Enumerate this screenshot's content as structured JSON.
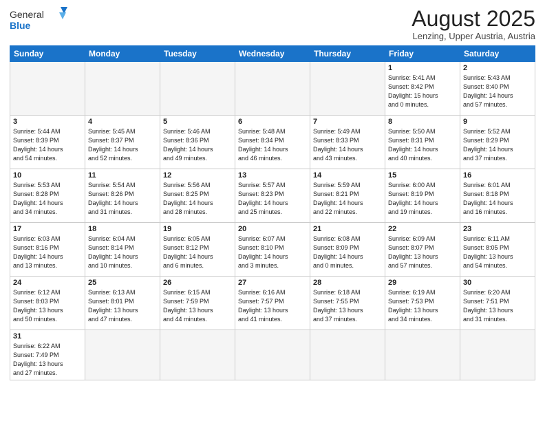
{
  "logo": {
    "text_general": "General",
    "text_blue": "Blue"
  },
  "title": "August 2025",
  "location": "Lenzing, Upper Austria, Austria",
  "weekdays": [
    "Sunday",
    "Monday",
    "Tuesday",
    "Wednesday",
    "Thursday",
    "Friday",
    "Saturday"
  ],
  "days": {
    "d1": {
      "num": "1",
      "info": "Sunrise: 5:41 AM\nSunset: 8:42 PM\nDaylight: 15 hours\nand 0 minutes."
    },
    "d2": {
      "num": "2",
      "info": "Sunrise: 5:43 AM\nSunset: 8:40 PM\nDaylight: 14 hours\nand 57 minutes."
    },
    "d3": {
      "num": "3",
      "info": "Sunrise: 5:44 AM\nSunset: 8:39 PM\nDaylight: 14 hours\nand 54 minutes."
    },
    "d4": {
      "num": "4",
      "info": "Sunrise: 5:45 AM\nSunset: 8:37 PM\nDaylight: 14 hours\nand 52 minutes."
    },
    "d5": {
      "num": "5",
      "info": "Sunrise: 5:46 AM\nSunset: 8:36 PM\nDaylight: 14 hours\nand 49 minutes."
    },
    "d6": {
      "num": "6",
      "info": "Sunrise: 5:48 AM\nSunset: 8:34 PM\nDaylight: 14 hours\nand 46 minutes."
    },
    "d7": {
      "num": "7",
      "info": "Sunrise: 5:49 AM\nSunset: 8:33 PM\nDaylight: 14 hours\nand 43 minutes."
    },
    "d8": {
      "num": "8",
      "info": "Sunrise: 5:50 AM\nSunset: 8:31 PM\nDaylight: 14 hours\nand 40 minutes."
    },
    "d9": {
      "num": "9",
      "info": "Sunrise: 5:52 AM\nSunset: 8:29 PM\nDaylight: 14 hours\nand 37 minutes."
    },
    "d10": {
      "num": "10",
      "info": "Sunrise: 5:53 AM\nSunset: 8:28 PM\nDaylight: 14 hours\nand 34 minutes."
    },
    "d11": {
      "num": "11",
      "info": "Sunrise: 5:54 AM\nSunset: 8:26 PM\nDaylight: 14 hours\nand 31 minutes."
    },
    "d12": {
      "num": "12",
      "info": "Sunrise: 5:56 AM\nSunset: 8:25 PM\nDaylight: 14 hours\nand 28 minutes."
    },
    "d13": {
      "num": "13",
      "info": "Sunrise: 5:57 AM\nSunset: 8:23 PM\nDaylight: 14 hours\nand 25 minutes."
    },
    "d14": {
      "num": "14",
      "info": "Sunrise: 5:59 AM\nSunset: 8:21 PM\nDaylight: 14 hours\nand 22 minutes."
    },
    "d15": {
      "num": "15",
      "info": "Sunrise: 6:00 AM\nSunset: 8:19 PM\nDaylight: 14 hours\nand 19 minutes."
    },
    "d16": {
      "num": "16",
      "info": "Sunrise: 6:01 AM\nSunset: 8:18 PM\nDaylight: 14 hours\nand 16 minutes."
    },
    "d17": {
      "num": "17",
      "info": "Sunrise: 6:03 AM\nSunset: 8:16 PM\nDaylight: 14 hours\nand 13 minutes."
    },
    "d18": {
      "num": "18",
      "info": "Sunrise: 6:04 AM\nSunset: 8:14 PM\nDaylight: 14 hours\nand 10 minutes."
    },
    "d19": {
      "num": "19",
      "info": "Sunrise: 6:05 AM\nSunset: 8:12 PM\nDaylight: 14 hours\nand 6 minutes."
    },
    "d20": {
      "num": "20",
      "info": "Sunrise: 6:07 AM\nSunset: 8:10 PM\nDaylight: 14 hours\nand 3 minutes."
    },
    "d21": {
      "num": "21",
      "info": "Sunrise: 6:08 AM\nSunset: 8:09 PM\nDaylight: 14 hours\nand 0 minutes."
    },
    "d22": {
      "num": "22",
      "info": "Sunrise: 6:09 AM\nSunset: 8:07 PM\nDaylight: 13 hours\nand 57 minutes."
    },
    "d23": {
      "num": "23",
      "info": "Sunrise: 6:11 AM\nSunset: 8:05 PM\nDaylight: 13 hours\nand 54 minutes."
    },
    "d24": {
      "num": "24",
      "info": "Sunrise: 6:12 AM\nSunset: 8:03 PM\nDaylight: 13 hours\nand 50 minutes."
    },
    "d25": {
      "num": "25",
      "info": "Sunrise: 6:13 AM\nSunset: 8:01 PM\nDaylight: 13 hours\nand 47 minutes."
    },
    "d26": {
      "num": "26",
      "info": "Sunrise: 6:15 AM\nSunset: 7:59 PM\nDaylight: 13 hours\nand 44 minutes."
    },
    "d27": {
      "num": "27",
      "info": "Sunrise: 6:16 AM\nSunset: 7:57 PM\nDaylight: 13 hours\nand 41 minutes."
    },
    "d28": {
      "num": "28",
      "info": "Sunrise: 6:18 AM\nSunset: 7:55 PM\nDaylight: 13 hours\nand 37 minutes."
    },
    "d29": {
      "num": "29",
      "info": "Sunrise: 6:19 AM\nSunset: 7:53 PM\nDaylight: 13 hours\nand 34 minutes."
    },
    "d30": {
      "num": "30",
      "info": "Sunrise: 6:20 AM\nSunset: 7:51 PM\nDaylight: 13 hours\nand 31 minutes."
    },
    "d31": {
      "num": "31",
      "info": "Sunrise: 6:22 AM\nSunset: 7:49 PM\nDaylight: 13 hours\nand 27 minutes."
    }
  }
}
